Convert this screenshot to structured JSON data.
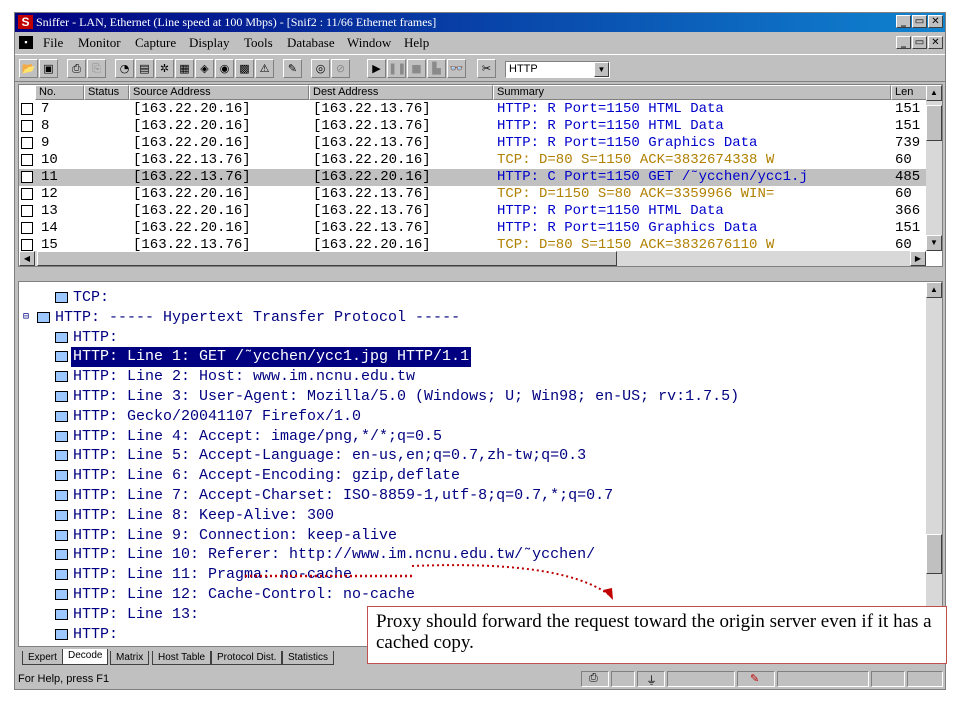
{
  "window": {
    "title": "Sniffer - LAN, Ethernet (Line speed at 100 Mbps) - [Snif2 : 11/66 Ethernet frames]",
    "app_icon": "S"
  },
  "menu": [
    "File",
    "Monitor",
    "Capture",
    "Display",
    "Tools",
    "Database",
    "Window",
    "Help"
  ],
  "toolbar": {
    "protocol_filter": "HTTP"
  },
  "packet_list": {
    "columns": [
      "No.",
      "Status",
      "Source Address",
      "Dest Address",
      "Summary",
      "Len"
    ],
    "rows": [
      {
        "no": "7",
        "src": "[163.22.20.16]",
        "dst": "[163.22.13.76]",
        "summary": "HTTP: R Port=1150 HTML Data",
        "len": "151",
        "proto": "http"
      },
      {
        "no": "8",
        "src": "[163.22.20.16]",
        "dst": "[163.22.13.76]",
        "summary": "HTTP: R Port=1150 HTML Data",
        "len": "151",
        "proto": "http"
      },
      {
        "no": "9",
        "src": "[163.22.20.16]",
        "dst": "[163.22.13.76]",
        "summary": "HTTP: R Port=1150 Graphics Data",
        "len": "739",
        "proto": "http"
      },
      {
        "no": "10",
        "src": "[163.22.13.76]",
        "dst": "[163.22.20.16]",
        "summary": "TCP: D=80 S=1150      ACK=3832674338 W",
        "len": "60",
        "proto": "tcp"
      },
      {
        "no": "11",
        "src": "[163.22.13.76]",
        "dst": "[163.22.20.16]",
        "summary": "HTTP: C Port=1150 GET /˜ycchen/ycc1.j",
        "len": "485",
        "proto": "http"
      },
      {
        "no": "12",
        "src": "[163.22.20.16]",
        "dst": "[163.22.13.76]",
        "summary": "TCP: D=1150 S=80      ACK=3359966 WIN=",
        "len": "60",
        "proto": "tcp"
      },
      {
        "no": "13",
        "src": "[163.22.20.16]",
        "dst": "[163.22.13.76]",
        "summary": "HTTP: R Port=1150 HTML Data",
        "len": "366",
        "proto": "http"
      },
      {
        "no": "14",
        "src": "[163.22.20.16]",
        "dst": "[163.22.13.76]",
        "summary": "HTTP: R Port=1150 Graphics Data",
        "len": "151",
        "proto": "http"
      },
      {
        "no": "15",
        "src": "[163.22.13.76]",
        "dst": "[163.22.20.16]",
        "summary": "TCP: D=80 S=1150      ACK=3832676110 W",
        "len": "60",
        "proto": "tcp"
      }
    ]
  },
  "decode_tree": [
    {
      "label": "TCP:",
      "level": 1
    },
    {
      "label": "HTTP: ----- Hypertext Transfer Protocol -----",
      "level": 0
    },
    {
      "label": "HTTP:",
      "level": 1
    },
    {
      "label": "HTTP: Line  1:  GET /˜ycchen/ycc1.jpg HTTP/1.1",
      "level": 1,
      "selected": true
    },
    {
      "label": "HTTP: Line  2:  Host: www.im.ncnu.edu.tw",
      "level": 1
    },
    {
      "label": "HTTP: Line  3:  User-Agent: Mozilla/5.0 (Windows; U; Win98; en-US; rv:1.7.5)",
      "level": 1
    },
    {
      "label": "HTTP:            Gecko/20041107 Firefox/1.0",
      "level": 1
    },
    {
      "label": "HTTP: Line  4:  Accept: image/png,*/*;q=0.5",
      "level": 1
    },
    {
      "label": "HTTP: Line  5:  Accept-Language: en-us,en;q=0.7,zh-tw;q=0.3",
      "level": 1
    },
    {
      "label": "HTTP: Line  6:  Accept-Encoding: gzip,deflate",
      "level": 1
    },
    {
      "label": "HTTP: Line  7:  Accept-Charset: ISO-8859-1,utf-8;q=0.7,*;q=0.7",
      "level": 1
    },
    {
      "label": "HTTP: Line  8:  Keep-Alive: 300",
      "level": 1
    },
    {
      "label": "HTTP: Line  9:  Connection: keep-alive",
      "level": 1
    },
    {
      "label": "HTTP: Line 10:  Referer: http://www.im.ncnu.edu.tw/˜ycchen/",
      "level": 1
    },
    {
      "label": "HTTP: Line 11:  Pragma: no-cache",
      "level": 1
    },
    {
      "label": "HTTP: Line 12:  Cache-Control: no-cache",
      "level": 1
    },
    {
      "label": "HTTP: Line 13:",
      "level": 1
    },
    {
      "label": "HTTP:",
      "level": 1
    }
  ],
  "tabs": [
    "Expert",
    "Decode",
    "Matrix",
    "Host Table",
    "Protocol Dist.",
    "Statistics"
  ],
  "active_tab": "Decode",
  "status": {
    "help": "For Help, press F1"
  },
  "annotation": {
    "text": "Proxy should forward the request toward the origin server even if it has a cached copy."
  },
  "colors": {
    "tcp": "#b08000",
    "http": "#0000cc",
    "tree_text": "#000080",
    "selection": "#000080",
    "callout_border": "#c0504d",
    "highlight_underline": "#c00000"
  }
}
